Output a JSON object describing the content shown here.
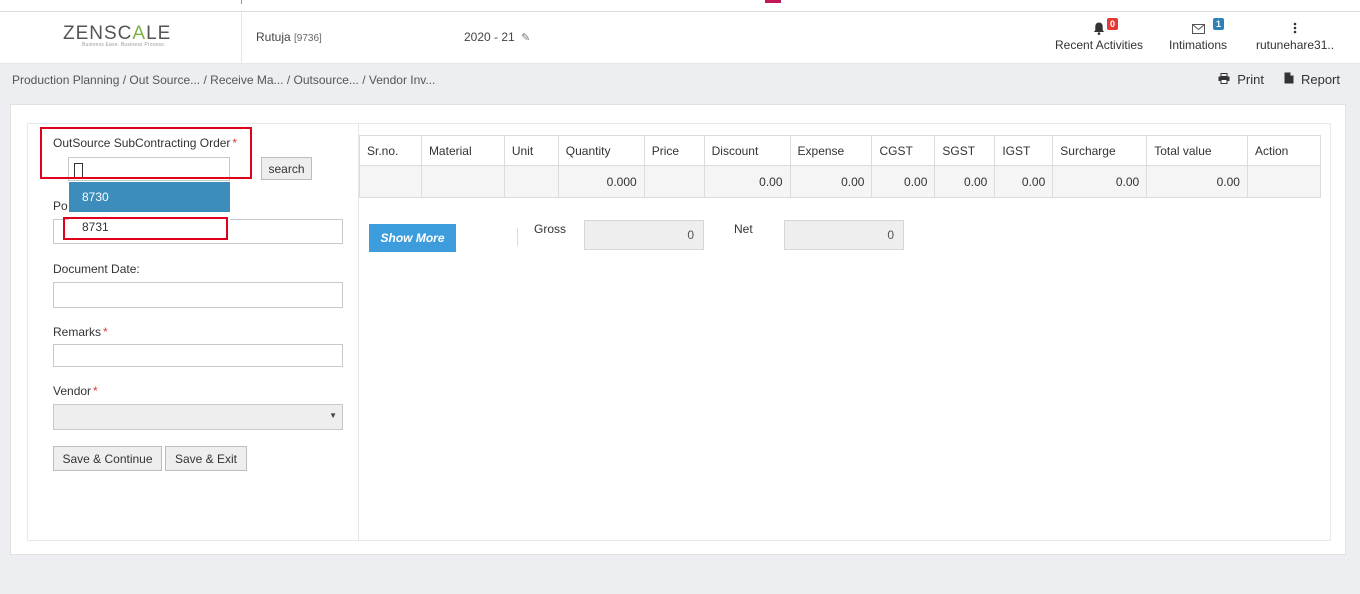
{
  "brand": {
    "logo_left": "ZENSC",
    "logo_mid": "A",
    "logo_right": "LE",
    "tagline": "Business Ease. Business Process."
  },
  "header": {
    "user_name": "Rutuja",
    "user_id": "[9736]",
    "fiscal_year": "2020 - 21",
    "recent_activities": {
      "label": "Recent Activities",
      "count": "0"
    },
    "intimations": {
      "label": "Intimations",
      "count": "1"
    },
    "account": "rutunehare31.."
  },
  "breadcrumb": {
    "items": [
      "Production Planning",
      " / Out Source...",
      " / Receive Ma...",
      " / Outsource...",
      " / Vendor Inv..."
    ]
  },
  "top_actions": {
    "print": "Print",
    "report": "Report"
  },
  "form": {
    "order_label": "OutSource SubContracting Order",
    "required_mark": "*",
    "search_button": "search",
    "options": [
      "8730",
      "8731"
    ],
    "posting_label": "Po",
    "document_date_label": "Document Date:",
    "remarks_label": "Remarks",
    "vendor_label": "Vendor",
    "dropdown_arrow": "▼",
    "save_continue": "Save & Continue",
    "save_exit": "Save & Exit"
  },
  "table": {
    "headers": [
      "Sr.no.",
      "Material",
      "Unit",
      "Quantity",
      "Price",
      "Discount",
      "Expense",
      "CGST",
      "SGST",
      "IGST",
      "Surcharge",
      "Total value",
      "Action"
    ],
    "row": [
      "",
      "",
      "",
      "0.000",
      "",
      "0.00",
      "0.00",
      "0.00",
      "0.00",
      "0.00",
      "0.00",
      "0.00",
      ""
    ]
  },
  "summary": {
    "show_more": "Show More",
    "gross_label": "Gross",
    "gross_value": "0",
    "net_label": "Net",
    "net_value": "0"
  },
  "colors": {
    "accent": "#3c9cdc",
    "highlight_red": "#e0001b",
    "selected_option": "#3c8dbc",
    "logo_green": "#7cb342"
  }
}
